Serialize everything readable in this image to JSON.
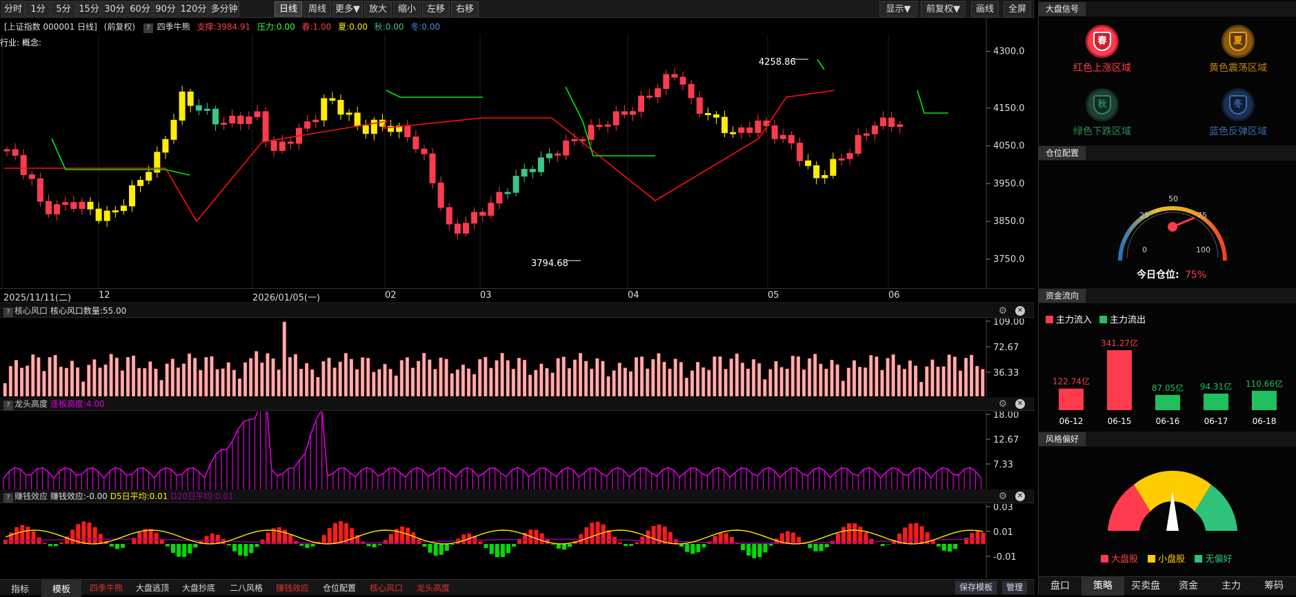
{
  "toolbar": {
    "periods": [
      "分时",
      "1分",
      "5分",
      "15分",
      "30分",
      "60分",
      "90分",
      "120分",
      "多分钟",
      "日线",
      "周线",
      "更多▼",
      "放大",
      "缩小",
      "左移",
      "右移"
    ],
    "active": "日线",
    "right": [
      "显示▼",
      "前复权▼",
      "画线",
      "全屏"
    ]
  },
  "chart": {
    "title": "[上证指数 000001 日线]",
    "adjust": "(前复权)",
    "indicator_name": "四季牛熊",
    "support": "支撑:3984.91",
    "pressure": "压力:0.00",
    "spring": "春:1.00",
    "summer": "夏:0.00",
    "autumn": "秋:0.00",
    "winter": "冬:0.00",
    "industry": "行业: 概念:",
    "high_label": "4258.86",
    "low_label": "3794.68",
    "price_ticks": [
      "4300.0",
      "4150.0",
      "4050.0",
      "3950.0",
      "3850.0",
      "3750.0"
    ],
    "dates": [
      "2025/11/11(二)",
      "12",
      "2026/01/05(一)",
      "02",
      "03",
      "04",
      "05",
      "06"
    ],
    "colors": {
      "up": "#ff3b4e",
      "down": "#3cc586",
      "spring": "#ff2222",
      "summer": "#ffee00",
      "support": "#ff1010",
      "pressure": "#00ee00"
    }
  },
  "panels": {
    "p1": {
      "name": "核心风口",
      "label": "核心风口数量:55.00",
      "ticks": [
        "109.00",
        "72.67",
        "36.33"
      ]
    },
    "p2": {
      "name": "龙头高度",
      "label": "连板高度:4.00",
      "ticks": [
        "18.00",
        "12.67",
        "7.33"
      ]
    },
    "p3": {
      "name": "赚钱效应",
      "label": "赚钱效应:-0.00",
      "d5": "D5日平均:0.01",
      "d20": "D20日平均:0.01",
      "ticks": [
        "0.03",
        "0.01",
        "-0.01"
      ]
    }
  },
  "bottom": {
    "tabs": [
      "指标",
      "模板"
    ],
    "active": "模板",
    "items": [
      "四季牛熊",
      "大盘逃顶",
      "大盘抄底",
      "二八风格",
      "赚钱效应",
      "仓位配置",
      "核心风口",
      "龙头高度"
    ],
    "save": "保存模板",
    "manage": "管理"
  },
  "sidebar": {
    "signal_title": "大盘信号",
    "seasons": [
      {
        "char": "春",
        "label": "红色上涨区域",
        "color": "#ff3b4e",
        "active": true
      },
      {
        "char": "夏",
        "label": "黄色震荡区域",
        "color": "#f0a020",
        "active": false
      },
      {
        "char": "秋",
        "label": "绿色下跌区域",
        "color": "#2a8a5a",
        "active": false
      },
      {
        "char": "冬",
        "label": "蓝色反弹区域",
        "color": "#3a6ab0",
        "active": false
      }
    ],
    "position_title": "仓位配置",
    "gauge_ticks": [
      "0",
      "25",
      "50",
      "75",
      "100"
    ],
    "position_label": "今日仓位:",
    "position_value": "75%",
    "position_fraction": 0.75,
    "flow_title": "资金流向",
    "inflow": "主力流入",
    "outflow": "主力流出",
    "flows": [
      {
        "date": "06-12",
        "value": 122.74,
        "label": "122.74亿",
        "dir": "in"
      },
      {
        "date": "06-15",
        "value": 341.27,
        "label": "341.27亿",
        "dir": "in"
      },
      {
        "date": "06-16",
        "value": 87.05,
        "label": "87.05亿",
        "dir": "out"
      },
      {
        "date": "06-17",
        "value": 94.31,
        "label": "94.31亿",
        "dir": "out"
      },
      {
        "date": "06-18",
        "value": 110.66,
        "label": "110.66亿",
        "dir": "out"
      }
    ],
    "style_title": "风格偏好",
    "styles": [
      "大盘股",
      "小盘股",
      "无偏好"
    ],
    "nav": [
      "盘口",
      "策略",
      "买卖盘",
      "资金",
      "主力",
      "筹码"
    ],
    "nav_active": "策略"
  }
}
